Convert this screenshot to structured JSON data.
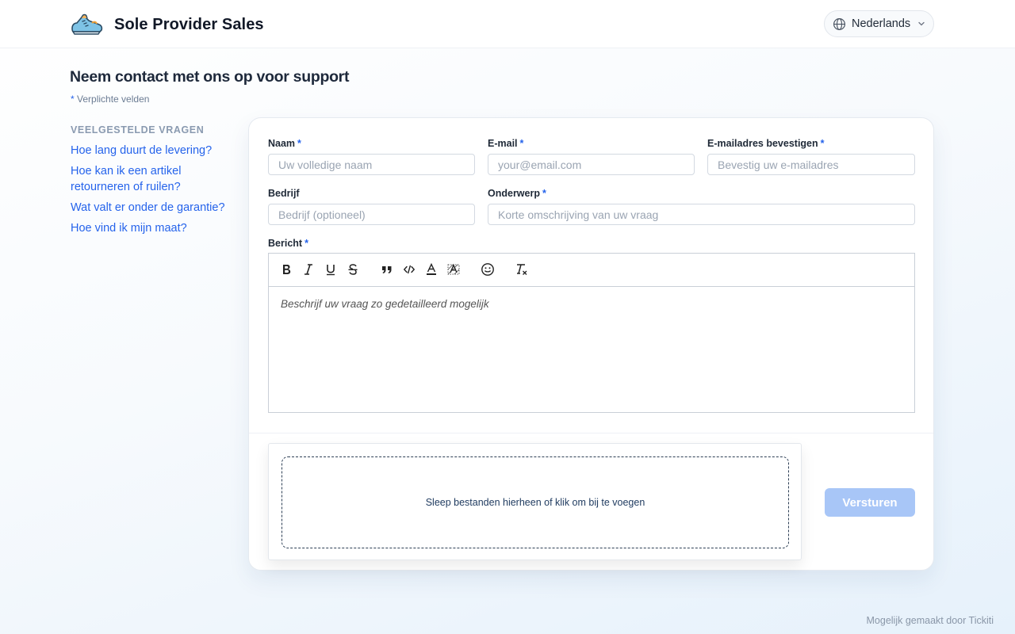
{
  "header": {
    "brand_name": "Sole Provider Sales",
    "logo_icon": "sneaker-logo",
    "language_label": "Nederlands"
  },
  "page": {
    "title": "Neem contact met ons op voor support",
    "required_note": "Verplichte velden"
  },
  "faq": {
    "heading": "VEELGESTELDE VRAGEN",
    "links": [
      "Hoe lang duurt de levering?",
      "Hoe kan ik een artikel retourneren of ruilen?",
      "Wat valt er onder de garantie?",
      "Hoe vind ik mijn maat?"
    ]
  },
  "form": {
    "name": {
      "label": "Naam",
      "placeholder": "Uw volledige naam",
      "value": ""
    },
    "email": {
      "label": "E-mail",
      "placeholder": "your@email.com",
      "value": ""
    },
    "email_confirm": {
      "label": "E-mailadres bevestigen",
      "placeholder": "Bevestig uw e-mailadres",
      "value": ""
    },
    "company": {
      "label": "Bedrijf",
      "placeholder": "Bedrijf (optioneel)",
      "value": ""
    },
    "subject": {
      "label": "Onderwerp",
      "placeholder": "Korte omschrijving van uw vraag",
      "value": ""
    },
    "message": {
      "label": "Bericht",
      "placeholder": "Beschrijf uw vraag zo gedetailleerd mogelijk",
      "toolbar": [
        "bold-icon",
        "italic-icon",
        "underline-icon",
        "strikethrough-icon",
        "quote-icon",
        "code-icon",
        "font-color-icon",
        "background-color-icon",
        "emoji-icon",
        "clear-format-icon"
      ]
    },
    "dropzone_text": "Sleep bestanden hierheen of klik om bij te voegen",
    "submit_label": "Versturen",
    "required_marker": "*"
  },
  "footer": {
    "credit": "Mogelijk gemaakt door Tickiti"
  },
  "colors": {
    "accent": "#2563eb",
    "submit_disabled": "#a8c6f7",
    "heading": "#1e293b"
  }
}
